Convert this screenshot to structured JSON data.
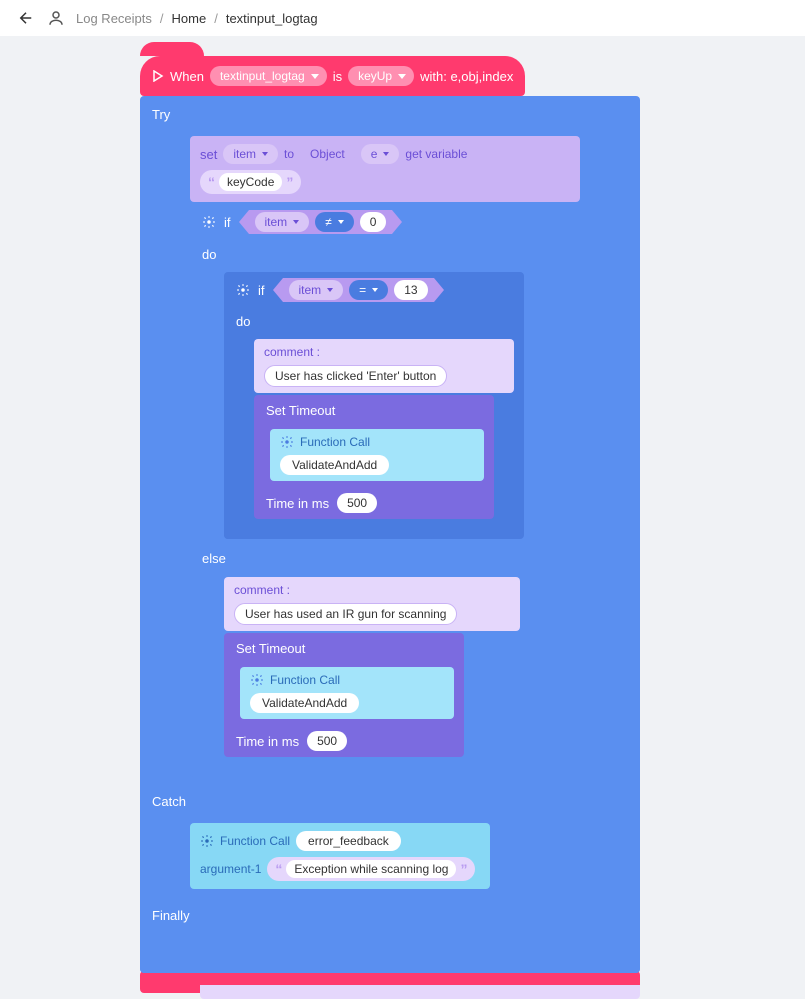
{
  "breadcrumb": {
    "app": "Log Receipts",
    "home": "Home",
    "current": "textinput_logtag"
  },
  "hat": {
    "when": "When",
    "widget": "textinput_logtag",
    "is": "is",
    "event": "keyUp",
    "with": "with: e,obj,index"
  },
  "try": {
    "label": "Try"
  },
  "set": {
    "label": "set",
    "item": "item",
    "to": "to",
    "object": "Object",
    "e": "e",
    "getvar": "get variable",
    "keycode": "keyCode"
  },
  "if1": {
    "label": "if",
    "item": "item",
    "op": "≠",
    "val": "0"
  },
  "do1": {
    "label": "do"
  },
  "if2": {
    "label": "if",
    "item": "item",
    "op": "=",
    "val": "13"
  },
  "do2": {
    "label": "do"
  },
  "comment1": {
    "label": "comment :",
    "text": "User has clicked 'Enter' button"
  },
  "timeout1": {
    "label": "Set Timeout",
    "timein": "Time in ms",
    "ms": "500"
  },
  "fc1": {
    "label": "Function Call",
    "name": "ValidateAndAdd"
  },
  "else": {
    "label": "else"
  },
  "comment2": {
    "label": "comment :",
    "text": "User has used an IR gun for scanning"
  },
  "timeout2": {
    "label": "Set Timeout",
    "timein": "Time in ms",
    "ms": "500"
  },
  "fc2": {
    "label": "Function Call",
    "name": "ValidateAndAdd"
  },
  "catch": {
    "label": "Catch"
  },
  "fc3": {
    "label": "Function Call",
    "name": "error_feedback"
  },
  "arg1": {
    "label": "argument-1",
    "text": "Exception while scanning log"
  },
  "finally": {
    "label": "Finally"
  }
}
